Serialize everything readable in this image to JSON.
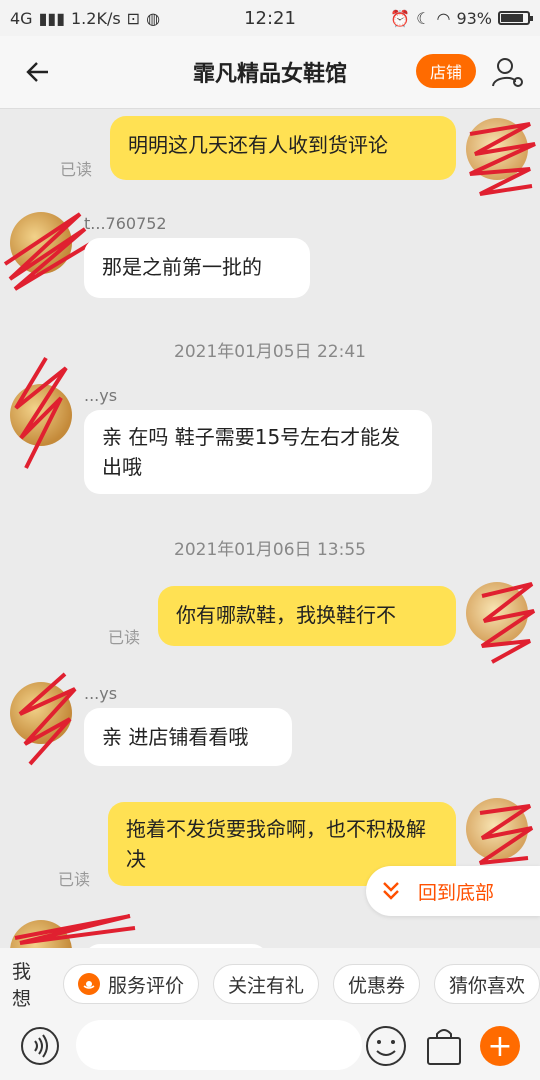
{
  "status_bar": {
    "network": "4G",
    "speed": "1.2K/s",
    "time": "12:21",
    "battery": "93%"
  },
  "header": {
    "title": "霏凡精品女鞋馆",
    "shop_label": "店铺"
  },
  "messages": [
    {
      "side": "mine",
      "text": "明明这几天还有人收到货评论",
      "read": "已读"
    },
    {
      "side": "theirs",
      "nick": "t...760752",
      "text": "那是之前第一批的"
    },
    {
      "type": "time",
      "text": "2021年01月05日 22:41"
    },
    {
      "side": "theirs",
      "nick": "...ys",
      "text": "亲 在吗 鞋子需要15号左右才能发出哦"
    },
    {
      "type": "time",
      "text": "2021年01月06日 13:55"
    },
    {
      "side": "mine",
      "text": "你有哪款鞋，我换鞋行不",
      "read": "已读"
    },
    {
      "side": "theirs",
      "nick": "...ys",
      "text": "亲 进店铺看看哦"
    },
    {
      "side": "mine",
      "text": "拖着不发货要我命啊，也不积极解决",
      "read": "已读"
    }
  ],
  "scroll_bottom_label": "回到底部",
  "quick_replies": {
    "label": "我想",
    "chips": [
      "服务评价",
      "关注有礼",
      "优惠券",
      "猜你喜欢"
    ]
  },
  "colors": {
    "accent": "#ff6b00",
    "mine_bubble": "#ffe153",
    "theirs_bubble": "#ffffff",
    "background": "#ebebeb"
  }
}
